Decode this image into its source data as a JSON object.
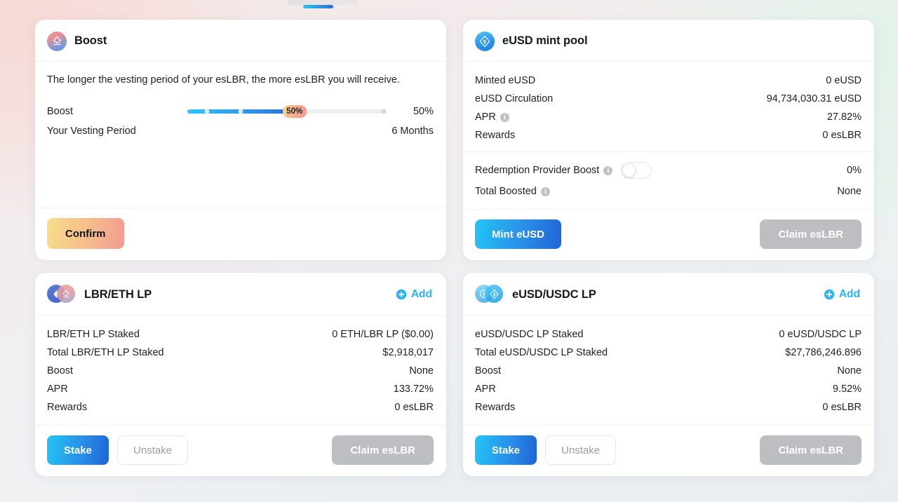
{
  "theme": {
    "accent_blue": "#29b6f6",
    "primary_gradient_from": "#23c5f7",
    "primary_gradient_to": "#1f63d6",
    "confirm_gradient_from": "#f8dd8b",
    "confirm_gradient_to": "#f29b92",
    "disabled_gray": "#bcbec1"
  },
  "boost_card": {
    "icon": "lybra-boost-icon",
    "title": "Boost",
    "description": "The longer the vesting period of your esLBR, the more esLBR you will receive.",
    "slider": {
      "label": "Boost",
      "thumb_label": "50%",
      "value_label": "50%",
      "value": 50,
      "min": 0,
      "max": 100
    },
    "vesting": {
      "label": "Your Vesting Period",
      "value": "6 Months"
    },
    "confirm_label": "Confirm"
  },
  "mint_pool_card": {
    "icon": "eusd-icon",
    "title": "eUSD mint pool",
    "rows": [
      {
        "label": "Minted eUSD",
        "value": "0 eUSD",
        "info": false
      },
      {
        "label": "eUSD Circulation",
        "value": "94,734,030.31 eUSD",
        "info": false
      },
      {
        "label": "APR",
        "value": "27.82%",
        "info": true
      },
      {
        "label": "Rewards",
        "value": "0 esLBR",
        "info": false
      }
    ],
    "redemption": {
      "label": "Redemption Provider Boost",
      "info": true,
      "toggle_on": false,
      "value": "0%"
    },
    "total_boosted": {
      "label": "Total Boosted",
      "info": true,
      "value": "None"
    },
    "mint_label": "Mint eUSD",
    "claim_label": "Claim esLBR"
  },
  "lbr_eth_card": {
    "icon": "lbr-eth-pair-icon",
    "title": "LBR/ETH LP",
    "add_label": "Add",
    "rows": [
      {
        "label": "LBR/ETH LP Staked",
        "value": "0 ETH/LBR LP ($0.00)"
      },
      {
        "label": "Total LBR/ETH LP Staked",
        "value": "$2,918,017"
      },
      {
        "label": "Boost",
        "value": "None"
      },
      {
        "label": "APR",
        "value": "133.72%"
      },
      {
        "label": "Rewards",
        "value": "0 esLBR"
      }
    ],
    "stake_label": "Stake",
    "unstake_label": "Unstake",
    "claim_label": "Claim esLBR"
  },
  "eusd_usdc_card": {
    "icon": "eusd-usdc-pair-icon",
    "title": "eUSD/USDC LP",
    "add_label": "Add",
    "rows": [
      {
        "label": "eUSD/USDC LP Staked",
        "value": "0 eUSD/USDC LP"
      },
      {
        "label": "Total eUSD/USDC LP Staked",
        "value": "$27,786,246.896"
      },
      {
        "label": "Boost",
        "value": "None"
      },
      {
        "label": "APR",
        "value": "9.52%"
      },
      {
        "label": "Rewards",
        "value": "0 esLBR"
      }
    ],
    "stake_label": "Stake",
    "unstake_label": "Unstake",
    "claim_label": "Claim esLBR"
  }
}
